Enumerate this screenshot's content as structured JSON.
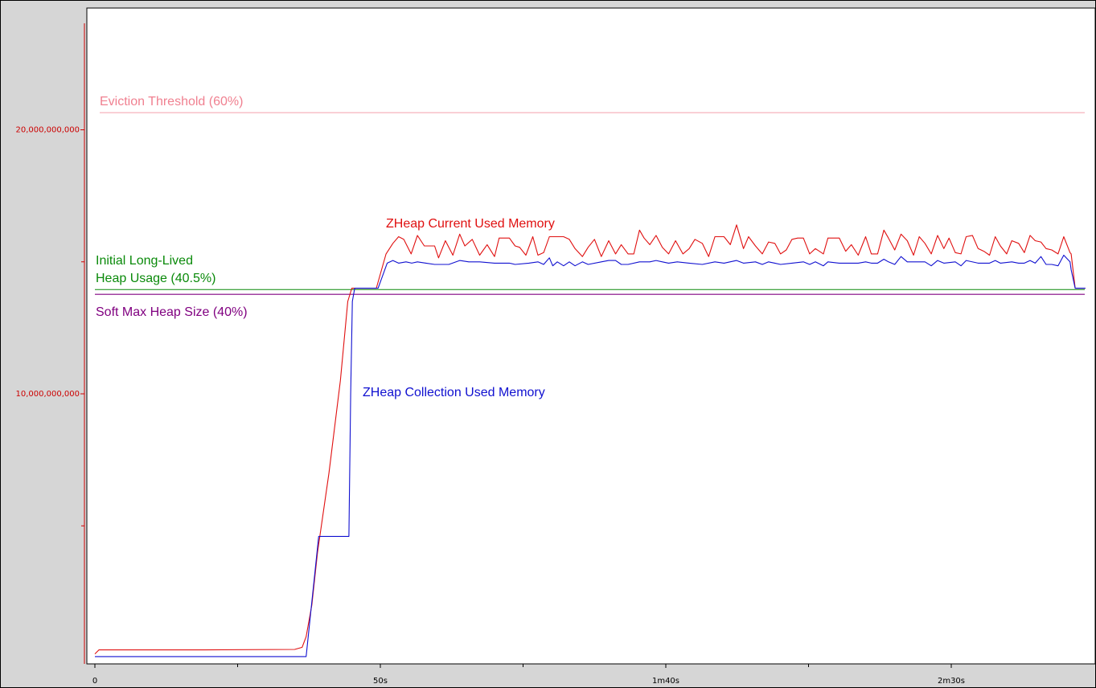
{
  "chart_data": {
    "type": "line",
    "title": "",
    "xlabel": "",
    "ylabel": "",
    "x_unit": "seconds",
    "xlim": [
      0,
      173
    ],
    "ylim": [
      0,
      24000000000
    ],
    "x_ticks": [
      {
        "value": 0,
        "label": "0"
      },
      {
        "value": 50,
        "label": "50s"
      },
      {
        "value": 100,
        "label": "1m40s"
      },
      {
        "value": 150,
        "label": "2m30s"
      }
    ],
    "x_minor_ticks": [
      25,
      75,
      125
    ],
    "y_ticks": [
      {
        "value": 10000000000,
        "label": "10,000,000,000"
      },
      {
        "value": 20000000000,
        "label": "20,000,000,000"
      }
    ],
    "y_minor_ticks": [
      5000000000,
      15000000000
    ],
    "grid": false,
    "colors": {
      "axis": "#cc0000",
      "current_used": "#e01010",
      "collection_used": "#1010d0",
      "eviction": "#f08090",
      "initial_long_lived": "#0a8a0a",
      "soft_max": "#800080"
    },
    "thresholds": [
      {
        "name": "Eviction Threshold (60%)",
        "value": 20650000000,
        "color": "#f08090"
      },
      {
        "name": "Initial Long-Lived Heap Usage (40.5%)",
        "value": 13950000000,
        "color": "#0a8a0a"
      },
      {
        "name": "Soft Max Heap Size (40%)",
        "value": 13770000000,
        "color": "#800080"
      }
    ],
    "annotations": {
      "eviction": "Eviction Threshold (60%)",
      "current": "ZHeap Current Used Memory",
      "initial_line1": "Initial Long-Lived",
      "initial_line2": "Heap Usage (40.5%)",
      "soft_max": "Soft Max Heap Size (40%)",
      "collection": "ZHeap Collection Used Memory"
    },
    "series": [
      {
        "name": "ZHeap Current Used Memory",
        "color": "#e01010",
        "points": [
          [
            0,
            150000000
          ],
          [
            0.7,
            300000000
          ],
          [
            17,
            300000000
          ],
          [
            35,
            320000000
          ],
          [
            36.3,
            400000000
          ],
          [
            37,
            800000000
          ],
          [
            38,
            2000000000
          ],
          [
            39,
            4000000000
          ],
          [
            41,
            7000000000
          ],
          [
            43,
            10500000000
          ],
          [
            44.3,
            13500000000
          ],
          [
            45,
            14000000000
          ],
          [
            49.3,
            14000000000
          ],
          [
            51,
            15300000000
          ],
          [
            52.2,
            15700000000
          ],
          [
            53.2,
            15950000000
          ],
          [
            54.1,
            15850000000
          ],
          [
            55.4,
            15300000000
          ],
          [
            56.5,
            16000000000
          ],
          [
            57.7,
            15600000000
          ],
          [
            59.5,
            15600000000
          ],
          [
            60.2,
            15150000000
          ],
          [
            61.4,
            15800000000
          ],
          [
            62.7,
            15250000000
          ],
          [
            63.9,
            16050000000
          ],
          [
            64.8,
            15600000000
          ],
          [
            66.1,
            15850000000
          ],
          [
            67.4,
            15250000000
          ],
          [
            68.7,
            15650000000
          ],
          [
            70,
            15200000000
          ],
          [
            70.8,
            15900000000
          ],
          [
            72.6,
            15900000000
          ],
          [
            73.6,
            15600000000
          ],
          [
            74.4,
            15550000000
          ],
          [
            75.5,
            15250000000
          ],
          [
            76.7,
            15950000000
          ],
          [
            77.6,
            15250000000
          ],
          [
            78.6,
            15350000000
          ],
          [
            79.6,
            15950000000
          ],
          [
            82.1,
            15950000000
          ],
          [
            83.1,
            15850000000
          ],
          [
            84.1,
            15500000000
          ],
          [
            85.4,
            15200000000
          ],
          [
            86.4,
            15550000000
          ],
          [
            87.5,
            15850000000
          ],
          [
            88.7,
            15200000000
          ],
          [
            90,
            15800000000
          ],
          [
            91.2,
            15300000000
          ],
          [
            92.2,
            15650000000
          ],
          [
            93.4,
            15300000000
          ],
          [
            94.4,
            15300000000
          ],
          [
            95.4,
            16200000000
          ],
          [
            96.2,
            15900000000
          ],
          [
            97.2,
            15650000000
          ],
          [
            98.3,
            16000000000
          ],
          [
            99.4,
            15550000000
          ],
          [
            100.5,
            15300000000
          ],
          [
            101.7,
            15800000000
          ],
          [
            103,
            15300000000
          ],
          [
            104.1,
            15500000000
          ],
          [
            105.1,
            15850000000
          ],
          [
            106.4,
            15700000000
          ],
          [
            107.5,
            15200000000
          ],
          [
            108.6,
            15950000000
          ],
          [
            110.2,
            15950000000
          ],
          [
            111.3,
            15650000000
          ],
          [
            112.4,
            16400000000
          ],
          [
            113.6,
            15500000000
          ],
          [
            114.5,
            15950000000
          ],
          [
            115.7,
            15600000000
          ],
          [
            116.9,
            15300000000
          ],
          [
            118,
            15750000000
          ],
          [
            119.1,
            15700000000
          ],
          [
            120.1,
            15300000000
          ],
          [
            121.1,
            15450000000
          ],
          [
            122.1,
            15850000000
          ],
          [
            123.1,
            15900000000
          ],
          [
            124.1,
            15900000000
          ],
          [
            125.2,
            15300000000
          ],
          [
            126.2,
            15500000000
          ],
          [
            127.6,
            15300000000
          ],
          [
            128.4,
            15900000000
          ],
          [
            130.4,
            15900000000
          ],
          [
            131.5,
            15400000000
          ],
          [
            132.5,
            15650000000
          ],
          [
            133.7,
            15250000000
          ],
          [
            135,
            15950000000
          ],
          [
            136,
            15300000000
          ],
          [
            137.1,
            15300000000
          ],
          [
            138.2,
            16200000000
          ],
          [
            139,
            15900000000
          ],
          [
            140.1,
            15450000000
          ],
          [
            141.2,
            16050000000
          ],
          [
            142.3,
            15800000000
          ],
          [
            143.4,
            15250000000
          ],
          [
            144.4,
            15950000000
          ],
          [
            145.4,
            15700000000
          ],
          [
            146.5,
            15300000000
          ],
          [
            147.6,
            16000000000
          ],
          [
            148.7,
            15500000000
          ],
          [
            149.6,
            15900000000
          ],
          [
            150.7,
            15350000000
          ],
          [
            151.7,
            15300000000
          ],
          [
            152.6,
            15950000000
          ],
          [
            153.7,
            16000000000
          ],
          [
            154.7,
            15500000000
          ],
          [
            155.7,
            15400000000
          ],
          [
            156.7,
            15250000000
          ],
          [
            157.7,
            15950000000
          ],
          [
            158.6,
            15600000000
          ],
          [
            159.7,
            15300000000
          ],
          [
            160.6,
            15800000000
          ],
          [
            161.8,
            15700000000
          ],
          [
            162.8,
            15350000000
          ],
          [
            163.8,
            16000000000
          ],
          [
            164.7,
            15800000000
          ],
          [
            165.7,
            15750000000
          ],
          [
            166.6,
            15500000000
          ],
          [
            167.6,
            15450000000
          ],
          [
            168.7,
            15300000000
          ],
          [
            169.7,
            15950000000
          ],
          [
            170.8,
            15350000000
          ],
          [
            171,
            15300000000
          ],
          [
            171.7,
            14000000000
          ],
          [
            173.5,
            14000000000
          ]
        ]
      },
      {
        "name": "ZHeap Collection Used Memory",
        "color": "#1010d0",
        "points": [
          [
            0,
            50000000
          ],
          [
            37,
            50000000
          ],
          [
            39.2,
            4600000000
          ],
          [
            44.5,
            4600000000
          ],
          [
            44.8,
            10000000000
          ],
          [
            45.1,
            13500000000
          ],
          [
            45.5,
            14000000000
          ],
          [
            49.6,
            14000000000
          ],
          [
            51.2,
            14950000000
          ],
          [
            52.2,
            15050000000
          ],
          [
            53.2,
            14950000000
          ],
          [
            54.5,
            15000000000
          ],
          [
            55.5,
            14950000000
          ],
          [
            56.5,
            15000000000
          ],
          [
            58,
            14950000000
          ],
          [
            59.5,
            14900000000
          ],
          [
            62,
            14900000000
          ],
          [
            63.9,
            15050000000
          ],
          [
            65.5,
            15000000000
          ],
          [
            67.4,
            15000000000
          ],
          [
            70,
            14950000000
          ],
          [
            72.6,
            14950000000
          ],
          [
            73.6,
            14900000000
          ],
          [
            76,
            14950000000
          ],
          [
            77.6,
            15000000000
          ],
          [
            78.6,
            14900000000
          ],
          [
            79.6,
            15150000000
          ],
          [
            80.2,
            14850000000
          ],
          [
            81,
            15000000000
          ],
          [
            82.1,
            14850000000
          ],
          [
            83.1,
            15000000000
          ],
          [
            84.1,
            14850000000
          ],
          [
            85.4,
            15000000000
          ],
          [
            86.4,
            14900000000
          ],
          [
            88.7,
            15000000000
          ],
          [
            90,
            15050000000
          ],
          [
            91.2,
            15050000000
          ],
          [
            92.2,
            14900000000
          ],
          [
            93.4,
            14900000000
          ],
          [
            95.4,
            15000000000
          ],
          [
            97.2,
            15000000000
          ],
          [
            98.3,
            15050000000
          ],
          [
            99.4,
            15000000000
          ],
          [
            100.5,
            14950000000
          ],
          [
            102,
            15000000000
          ],
          [
            104.1,
            14950000000
          ],
          [
            106.4,
            14900000000
          ],
          [
            108.6,
            15000000000
          ],
          [
            110.2,
            14950000000
          ],
          [
            112.4,
            15050000000
          ],
          [
            113.6,
            14950000000
          ],
          [
            115.7,
            15000000000
          ],
          [
            116.9,
            14900000000
          ],
          [
            118,
            15000000000
          ],
          [
            119.1,
            14950000000
          ],
          [
            120.1,
            14900000000
          ],
          [
            122.1,
            14950000000
          ],
          [
            124.1,
            15000000000
          ],
          [
            125.2,
            14900000000
          ],
          [
            126.2,
            15000000000
          ],
          [
            127.6,
            14850000000
          ],
          [
            128.4,
            15000000000
          ],
          [
            130.4,
            14950000000
          ],
          [
            131.5,
            14950000000
          ],
          [
            133.7,
            14950000000
          ],
          [
            135,
            15000000000
          ],
          [
            136,
            14950000000
          ],
          [
            137.1,
            14950000000
          ],
          [
            138.2,
            15100000000
          ],
          [
            139,
            15000000000
          ],
          [
            140.1,
            14900000000
          ],
          [
            141.2,
            15200000000
          ],
          [
            142.3,
            15000000000
          ],
          [
            143.4,
            15000000000
          ],
          [
            145.4,
            15000000000
          ],
          [
            146.5,
            14850000000
          ],
          [
            147.6,
            15050000000
          ],
          [
            148.7,
            14950000000
          ],
          [
            150.7,
            15000000000
          ],
          [
            151.7,
            14850000000
          ],
          [
            152.6,
            15050000000
          ],
          [
            154.7,
            14950000000
          ],
          [
            156.7,
            14950000000
          ],
          [
            157.7,
            15050000000
          ],
          [
            158.6,
            14950000000
          ],
          [
            160.6,
            15000000000
          ],
          [
            161.8,
            14950000000
          ],
          [
            162.8,
            14950000000
          ],
          [
            163.8,
            15050000000
          ],
          [
            164.7,
            14950000000
          ],
          [
            165.7,
            15200000000
          ],
          [
            166.6,
            14900000000
          ],
          [
            167.6,
            14900000000
          ],
          [
            168.7,
            14850000000
          ],
          [
            169.7,
            15250000000
          ],
          [
            170.8,
            15000000000
          ],
          [
            171,
            14700000000
          ],
          [
            171.7,
            14000000000
          ],
          [
            173.5,
            14000000000
          ]
        ]
      }
    ]
  }
}
